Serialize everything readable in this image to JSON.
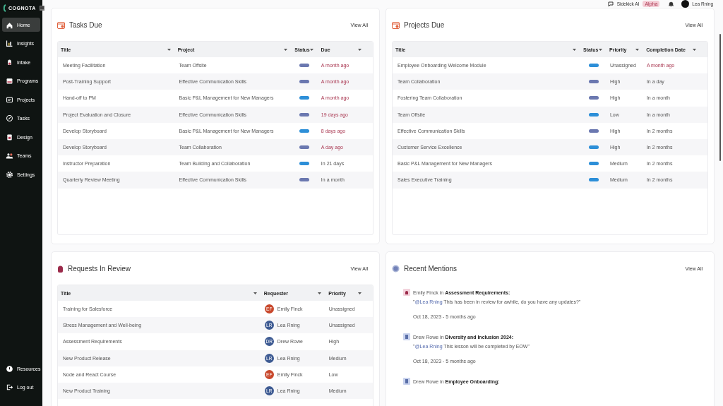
{
  "sidebar": {
    "logo": "COGNOTA",
    "items": [
      {
        "label": "Home",
        "selected": true
      },
      {
        "label": "Insights",
        "selected": false
      },
      {
        "label": "Intake",
        "selected": false
      },
      {
        "label": "Programs",
        "selected": false
      },
      {
        "label": "Projects",
        "selected": false
      },
      {
        "label": "Tasks",
        "selected": false
      },
      {
        "label": "Design",
        "selected": false
      },
      {
        "label": "Teams",
        "selected": false
      },
      {
        "label": "Settings",
        "selected": false
      }
    ],
    "footer_items": [
      {
        "label": "Resources"
      },
      {
        "label": "Log out"
      }
    ]
  },
  "top_bar": {
    "assistant": "Sidekick AI",
    "badge": "Alpha",
    "user": "Lea Rning"
  },
  "tasks_due": {
    "title": "Tasks Due",
    "view_all": "View All",
    "columns": [
      "Title",
      "Project",
      "Status",
      "Due"
    ],
    "rows": [
      {
        "title": "Meeting Facilitation",
        "project": "Team Offsite",
        "color": "#6b78b0",
        "due": "A month ago",
        "overdue": true
      },
      {
        "title": "Post-Training Support",
        "project": "Effective Communication Skills",
        "color": "#6b78b0",
        "due": "A month ago",
        "overdue": true
      },
      {
        "title": "Hand-off to PM",
        "project": "Basic P&L Management for New Managers",
        "color": "#2d8fd8",
        "due": "A month ago",
        "overdue": true
      },
      {
        "title": "Project Evaluation and Closure",
        "project": "Effective Communication Skills",
        "color": "#6b78b0",
        "due": "19 days ago",
        "overdue": true
      },
      {
        "title": "Develop Storyboard",
        "project": "Basic P&L Management for New Managers",
        "color": "#2d8fd8",
        "due": "8 days ago",
        "overdue": true
      },
      {
        "title": "Develop Storyboard",
        "project": "Team Collaboration",
        "color": "#6b78b0",
        "due": "A day ago",
        "overdue": true
      },
      {
        "title": "Instructor Preparation",
        "project": "Team Building and Collaboration",
        "color": "#2d8fd8",
        "due": "In 21 days",
        "overdue": false
      },
      {
        "title": "Quarterly Review Meeting",
        "project": "Effective Communication Skills",
        "color": "#6b78b0",
        "due": "In a month",
        "overdue": false
      }
    ]
  },
  "projects_due": {
    "title": "Projects Due",
    "view_all": "View All",
    "columns": [
      "Title",
      "Status",
      "Priority",
      "Completion Date"
    ],
    "rows": [
      {
        "title": "Employee Onboarding Welcome Module",
        "color": "#2d8fd8",
        "priority": "Unassigned",
        "due": "A month ago",
        "overdue": true
      },
      {
        "title": "Team Collaboration",
        "color": "#6b78b0",
        "priority": "High",
        "due": "In a day",
        "overdue": false
      },
      {
        "title": "Fostering Team Collaboration",
        "color": "#6b78b0",
        "priority": "High",
        "due": "In a month",
        "overdue": false
      },
      {
        "title": "Team Offsite",
        "color": "#2d8fd8",
        "priority": "Low",
        "due": "In a month",
        "overdue": false
      },
      {
        "title": "Effective Communication Skills",
        "color": "#6b78b0",
        "priority": "High",
        "due": "In 2 months",
        "overdue": false
      },
      {
        "title": "Customer Service Excellence",
        "color": "#2d8fd8",
        "priority": "High",
        "due": "In 2 months",
        "overdue": false
      },
      {
        "title": "Basic P&L Management for New Managers",
        "color": "#2d8fd8",
        "priority": "Medium",
        "due": "In 2 months",
        "overdue": false
      },
      {
        "title": "Sales Executive Training",
        "color": "#2d8fd8",
        "priority": "Medium",
        "due": "In 2 months",
        "overdue": false
      }
    ]
  },
  "requests_in_review": {
    "title": "Requests In Review",
    "view_all": "View All",
    "columns": [
      "Title",
      "Requester",
      "Priority"
    ],
    "rows": [
      {
        "title": "Training for Salesforce",
        "initials": "EF",
        "requester": "Emily Finck",
        "color": "#c8472b",
        "priority": "Unassigned"
      },
      {
        "title": "Stress Management and Well-being",
        "initials": "LR",
        "requester": "Lea Rning",
        "color": "#3e5b93",
        "priority": "Unassigned"
      },
      {
        "title": "Assessment Requirements",
        "initials": "DR",
        "requester": "Drew Rowe",
        "color": "#3e5b93",
        "priority": "High"
      },
      {
        "title": "New Product Release",
        "initials": "LR",
        "requester": "Lea Rning",
        "color": "#3e5b93",
        "priority": "Medium"
      },
      {
        "title": "Node and React Course",
        "initials": "EF",
        "requester": "Emily Finck",
        "color": "#c8472b",
        "priority": "Low"
      },
      {
        "title": "New Product Training",
        "initials": "LR",
        "requester": "Lea Rning",
        "color": "#3e5b93",
        "priority": "Medium"
      }
    ]
  },
  "recent_mentions": {
    "title": "Recent Mentions",
    "view_all": "View All",
    "items": [
      {
        "kind": "request",
        "heading": "Emily Finck in **Assessment Requirements:**",
        "open": "\"",
        "mention": "@Lea Rning",
        "text": " This has been in review for awhile, do you have any updates?\"",
        "date": "Oct 18, 2023 - 5 months ago"
      },
      {
        "kind": "project",
        "heading": "Drew Rowe in **Diversity and Inclusion 2024:**",
        "open": "\"",
        "mention": "@Lea Rning",
        "text": " This lesson will be completed by EOW\"",
        "date": "Oct 18, 2023 - 5 months ago"
      },
      {
        "kind": "project",
        "heading": "Drew Rowe in **Employee Onboarding:**"
      }
    ]
  }
}
